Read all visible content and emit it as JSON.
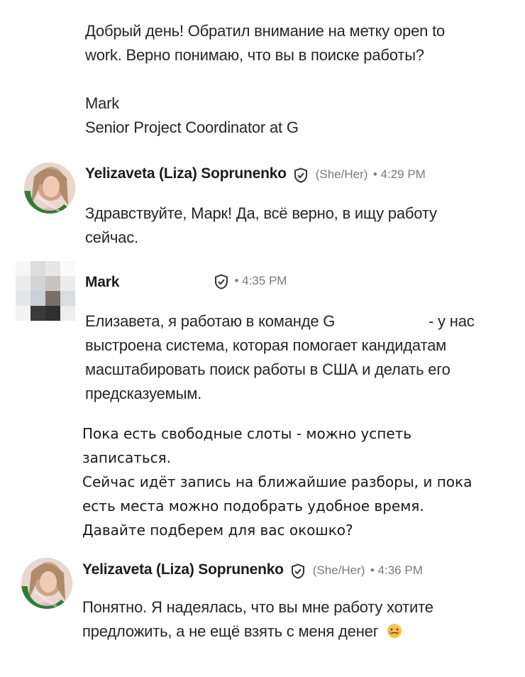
{
  "messages": [
    {
      "id": "m1",
      "text_lines": [
        "Добрый день! Обратил внимание на метку open to",
        "work. Верно понимаю, что вы в поиске работы?"
      ],
      "signature_lines": [
        "Mark",
        "Senior Project Coordinator at G"
      ]
    },
    {
      "id": "m2",
      "sender": "Yelizaveta (Liza) Soprunenko",
      "pronouns": "(She/Her)",
      "time": "• 4:29 PM",
      "text_lines": [
        "Здравствуйте, Марк! Да, всё верно, в ищу работу",
        "сейчас."
      ]
    },
    {
      "id": "m3",
      "sender": "Mark",
      "time": "• 4:35 PM",
      "text_lines": [
        "Елизавета, я работаю в команде G",
        "- у нас",
        "выстроена система, которая помогает кандидатам",
        "масштабировать поиск работы в США и делать его",
        "предсказуемым."
      ],
      "extra_lines": [
        "Пока есть свободные слоты - можно успеть",
        "записаться.",
        "Сейчас идёт запись на ближайшие разборы, и пока",
        "есть места можно подобрать удобное время.",
        "Давайте подберем для вас окошко?"
      ]
    },
    {
      "id": "m4",
      "sender": "Yelizaveta (Liza) Soprunenko",
      "pronouns": "(She/Her)",
      "time": "• 4:36 PM",
      "text_lines": [
        "Понятно. Я надеялась, что вы мне работу хотите",
        "предложить, а не ещё взять с меня денег"
      ]
    }
  ],
  "colors": {
    "text": "#262626",
    "meta": "#7a7a7a",
    "opentowork_ring": "#2f7d32"
  },
  "icons": [
    "verified-shield-icon",
    "blurred-avatar",
    "opentowork-avatar",
    "emoji-icon"
  ]
}
